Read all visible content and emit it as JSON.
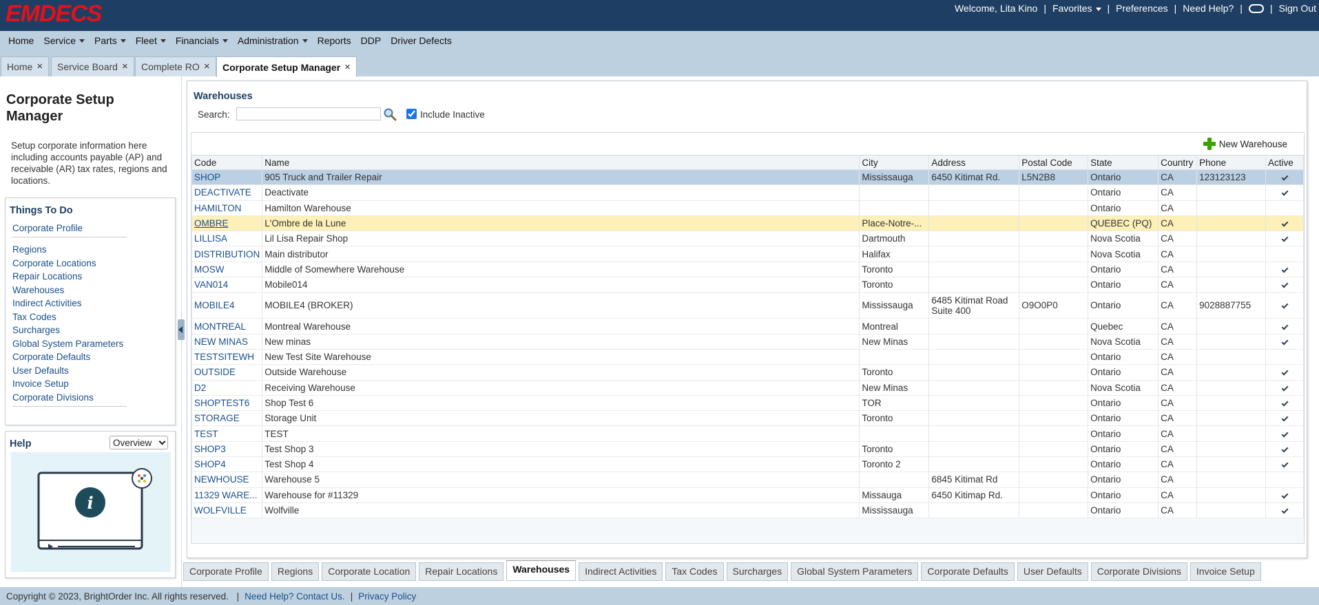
{
  "header": {
    "logo": "EMDECS",
    "welcome": "Welcome, Lita Kino",
    "favorites": "Favorites",
    "preferences": "Preferences",
    "need_help": "Need Help?",
    "sign_out": "Sign Out"
  },
  "nav": [
    {
      "label": "Home",
      "dropdown": false
    },
    {
      "label": "Service",
      "dropdown": true
    },
    {
      "label": "Parts",
      "dropdown": true
    },
    {
      "label": "Fleet",
      "dropdown": true
    },
    {
      "label": "Financials",
      "dropdown": true
    },
    {
      "label": "Administration",
      "dropdown": true
    },
    {
      "label": "Reports",
      "dropdown": false
    },
    {
      "label": "DDP",
      "dropdown": false
    },
    {
      "label": "Driver Defects",
      "dropdown": false
    }
  ],
  "tabs": [
    {
      "label": "Home",
      "active": false
    },
    {
      "label": "Service Board",
      "active": false
    },
    {
      "label": "Complete RO",
      "active": false
    },
    {
      "label": "Corporate Setup Manager",
      "active": true
    }
  ],
  "sidebar": {
    "title": "Corporate Setup Manager",
    "description": "Setup corporate information here including accounts payable (AP) and receivable (AR) tax rates, regions and locations.",
    "todo_title": "Things To Do",
    "links": [
      "Corporate Profile",
      "Regions",
      "Corporate Locations",
      "Repair Locations",
      "Warehouses",
      "Indirect Activities",
      "Tax Codes",
      "Surcharges",
      "Global System Parameters",
      "Corporate Defaults",
      "User Defaults",
      "Invoice Setup",
      "Corporate Divisions"
    ],
    "help_title": "Help",
    "help_option": "Overview"
  },
  "main": {
    "title": "Warehouses",
    "search_label": "Search:",
    "search_value": "",
    "include_inactive": "Include Inactive",
    "new_button": "New Warehouse",
    "columns": [
      "Code",
      "Name",
      "City",
      "Address",
      "Postal Code",
      "State",
      "Country",
      "Phone",
      "Active"
    ],
    "rows": [
      {
        "code": "SHOP",
        "name": "905 Truck and Trailer Repair",
        "city": "Mississauga",
        "address": "6450 Kitimat Rd.",
        "postal": "L5N2B8",
        "state": "Ontario",
        "country": "CA",
        "phone": "123123123",
        "active": true,
        "selected": true
      },
      {
        "code": "DEACTIVATE",
        "name": "Deactivate",
        "city": "",
        "address": "",
        "postal": "",
        "state": "Ontario",
        "country": "CA",
        "phone": "",
        "active": true
      },
      {
        "code": "HAMILTON",
        "name": "Hamilton Warehouse",
        "city": "",
        "address": "",
        "postal": "",
        "state": "Ontario",
        "country": "CA",
        "phone": "",
        "active": false
      },
      {
        "code": "OMBRE",
        "name": "L'Ombre de la Lune",
        "city": "Place-Notre-...",
        "address": "",
        "postal": "",
        "state": "QUEBEC (PQ)",
        "country": "CA",
        "phone": "",
        "active": true,
        "hover": true
      },
      {
        "code": "LILLISA",
        "name": "Lil Lisa Repair Shop",
        "city": "Dartmouth",
        "address": "",
        "postal": "",
        "state": "Nova Scotia",
        "country": "CA",
        "phone": "",
        "active": true
      },
      {
        "code": "DISTRIBUTION",
        "name": "Main distributor",
        "city": "Halifax",
        "address": "",
        "postal": "",
        "state": "Nova Scotia",
        "country": "CA",
        "phone": "",
        "active": false
      },
      {
        "code": "MOSW",
        "name": "Middle of Somewhere Warehouse",
        "city": "Toronto",
        "address": "",
        "postal": "",
        "state": "Ontario",
        "country": "CA",
        "phone": "",
        "active": true
      },
      {
        "code": "VAN014",
        "name": "Mobile014",
        "city": "Toronto",
        "address": "",
        "postal": "",
        "state": "Ontario",
        "country": "CA",
        "phone": "",
        "active": true
      },
      {
        "code": "MOBILE4",
        "name": "MOBILE4 (BROKER)",
        "city": "Mississauga",
        "address": "6485 Kitimat Road Suite 400",
        "postal": "O9O0P0",
        "state": "Ontario",
        "country": "CA",
        "phone": "9028887755",
        "active": true,
        "tall": true
      },
      {
        "code": "MONTREAL",
        "name": "Montreal Warehouse",
        "city": "Montreal",
        "address": "",
        "postal": "",
        "state": "Quebec",
        "country": "CA",
        "phone": "",
        "active": true
      },
      {
        "code": "NEW MINAS",
        "name": "New minas",
        "city": "New Minas",
        "address": "",
        "postal": "",
        "state": "Nova Scotia",
        "country": "CA",
        "phone": "",
        "active": true
      },
      {
        "code": "TESTSITEWH",
        "name": "New Test Site Warehouse",
        "city": "",
        "address": "",
        "postal": "",
        "state": "Ontario",
        "country": "CA",
        "phone": "",
        "active": false
      },
      {
        "code": "OUTSIDE",
        "name": "Outside Warehouse",
        "city": "Toronto",
        "address": "",
        "postal": "",
        "state": "Ontario",
        "country": "CA",
        "phone": "",
        "active": true
      },
      {
        "code": "D2",
        "name": "Receiving Warehouse",
        "city": "New Minas",
        "address": "",
        "postal": "",
        "state": "Nova Scotia",
        "country": "CA",
        "phone": "",
        "active": true
      },
      {
        "code": "SHOPTEST6",
        "name": "Shop Test 6",
        "city": "TOR",
        "address": "",
        "postal": "",
        "state": "Ontario",
        "country": "CA",
        "phone": "",
        "active": true
      },
      {
        "code": "STORAGE",
        "name": "Storage Unit",
        "city": "Toronto",
        "address": "",
        "postal": "",
        "state": "Ontario",
        "country": "CA",
        "phone": "",
        "active": true
      },
      {
        "code": "TEST",
        "name": "TEST",
        "city": "",
        "address": "",
        "postal": "",
        "state": "Ontario",
        "country": "CA",
        "phone": "",
        "active": true
      },
      {
        "code": "SHOP3",
        "name": "Test Shop 3",
        "city": "Toronto",
        "address": "",
        "postal": "",
        "state": "Ontario",
        "country": "CA",
        "phone": "",
        "active": true
      },
      {
        "code": "SHOP4",
        "name": "Test Shop 4",
        "city": "Toronto 2",
        "address": "",
        "postal": "",
        "state": "Ontario",
        "country": "CA",
        "phone": "",
        "active": true
      },
      {
        "code": "NEWHOUSE",
        "name": "Warehouse 5",
        "city": "",
        "address": "6845 Kitimat Rd",
        "postal": "",
        "state": "Ontario",
        "country": "CA",
        "phone": "",
        "active": false
      },
      {
        "code": "11329 WARE...",
        "name": "Warehouse for #11329",
        "city": "Missauga",
        "address": "6450 Kitimap Rd.",
        "postal": "",
        "state": "Ontario",
        "country": "CA",
        "phone": "",
        "active": true
      },
      {
        "code": "WOLFVILLE",
        "name": "Wolfville",
        "city": "Mississauga",
        "address": "",
        "postal": "",
        "state": "Ontario",
        "country": "CA",
        "phone": "",
        "active": true
      }
    ]
  },
  "bottom_tabs": [
    {
      "label": "Corporate Profile",
      "active": false
    },
    {
      "label": "Regions",
      "active": false
    },
    {
      "label": "Corporate Location",
      "active": false
    },
    {
      "label": "Repair Locations",
      "active": false
    },
    {
      "label": "Warehouses",
      "active": true
    },
    {
      "label": "Indirect Activities",
      "active": false
    },
    {
      "label": "Tax Codes",
      "active": false
    },
    {
      "label": "Surcharges",
      "active": false
    },
    {
      "label": "Global System Parameters",
      "active": false
    },
    {
      "label": "Corporate Defaults",
      "active": false
    },
    {
      "label": "User Defaults",
      "active": false
    },
    {
      "label": "Corporate Divisions",
      "active": false
    },
    {
      "label": "Invoice Setup",
      "active": false
    }
  ],
  "footer": {
    "copyright": "Copyright © 2023, BrightOrder Inc. All rights reserved.",
    "help_link": "Need Help? Contact Us.",
    "privacy": "Privacy Policy"
  },
  "colors": {
    "header_bg": "#1e3f63",
    "nav_bg": "#bdd0e0",
    "logo": "#e3121a",
    "link": "#1a4f8a",
    "selected_row": "#bcd0e4",
    "hover_row": "#fdf0b8"
  }
}
